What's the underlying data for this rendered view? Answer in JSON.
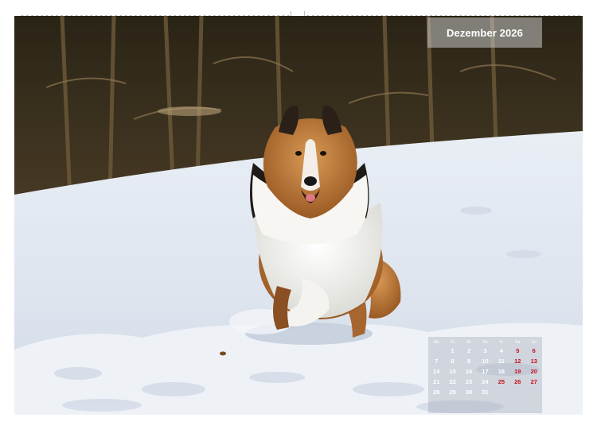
{
  "calendar": {
    "month_title": "Dezember 2026",
    "weekday_headers": [
      "Mo",
      "Di",
      "Mi",
      "Do",
      "Fr",
      "Sa",
      "So"
    ],
    "weeks": [
      [
        "",
        "1",
        "2",
        "3",
        "4",
        "5",
        "6"
      ],
      [
        "7",
        "8",
        "9",
        "10",
        "11",
        "12",
        "13"
      ],
      [
        "14",
        "15",
        "16",
        "17",
        "18",
        "19",
        "20"
      ],
      [
        "21",
        "22",
        "23",
        "24",
        "25",
        "26",
        "27"
      ],
      [
        "28",
        "29",
        "30",
        "31",
        "",
        "",
        ""
      ]
    ],
    "highlighted_days": [
      "5",
      "6",
      "12",
      "13",
      "19",
      "20",
      "25",
      "26",
      "27"
    ],
    "highlight_color": "#c8101e"
  },
  "photo": {
    "subject": "collie-dog-running-in-snow"
  }
}
